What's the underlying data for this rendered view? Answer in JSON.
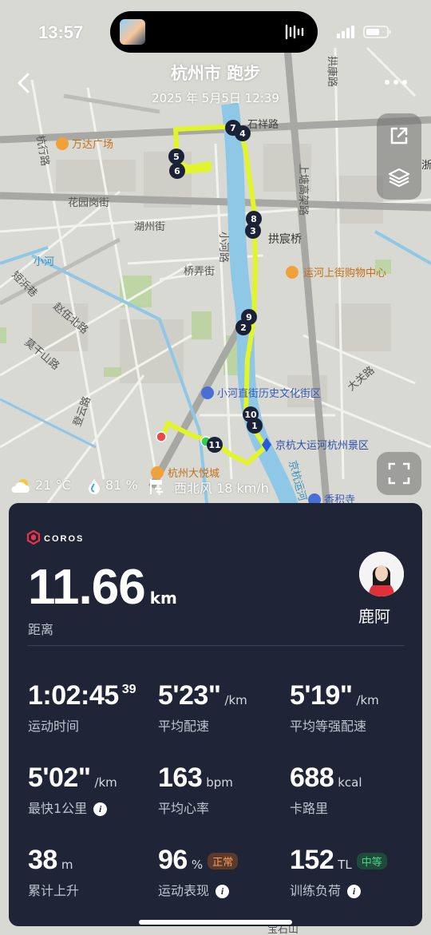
{
  "status_bar": {
    "time": "13:57"
  },
  "header": {
    "title": "杭州市 跑步",
    "subtitle": "2025 年 5月5日 12:39"
  },
  "map": {
    "labels": {
      "wanda": "万达广场",
      "shichiqiao": "石祥路",
      "gongchenqiao": "拱宸桥",
      "hangxing": "杭行路",
      "huayuangang": "花园岗街",
      "hubin": "湖州街",
      "qiaonong": "桥弄街",
      "xiaohe_road": "小河路",
      "xiaohe": "小河",
      "duanbang": "短浜巷",
      "zhaogong": "赵伍北路",
      "moganshan": "莫干山路",
      "dengyun": "登云路",
      "shangtang": "上塘高架路",
      "gongkang": "拱康路",
      "canal_mall": "运河上街购物中心",
      "historic": "小河直街历史文化街区",
      "scenic": "京杭大运河杭州景区",
      "mall": "杭州大悦城",
      "xiangji": "香积寺",
      "baoshi": "宝石山",
      "dagaun": "大关路",
      "canal_river": "京杭运河",
      "zheda": "浙大"
    },
    "markers": [
      "1",
      "2",
      "3",
      "4",
      "5",
      "6",
      "7",
      "8",
      "9",
      "10",
      "11"
    ],
    "route_color": "#e2f42a"
  },
  "weather": {
    "temp": "21 °C",
    "humidity": "81 %",
    "wind": "西北风 18 km/h"
  },
  "card": {
    "brand": "COROS",
    "distance_value": "11.66",
    "distance_unit": "km",
    "distance_label": "距离",
    "user_name": "鹿阿",
    "stats": {
      "duration": {
        "value": "1:02:45",
        "sup": "39",
        "label": "运动时间"
      },
      "avg_pace": {
        "value": "5'23\"",
        "unit": "/km",
        "label": "平均配速"
      },
      "gap_pace": {
        "value": "5'19\"",
        "unit": "/km",
        "label": "平均等强配速"
      },
      "fastest_km": {
        "value": "5'02\"",
        "unit": "/km",
        "label": "最快1公里"
      },
      "avg_hr": {
        "value": "163",
        "unit": "bpm",
        "label": "平均心率"
      },
      "calories": {
        "value": "688",
        "unit": "kcal",
        "label": "卡路里"
      },
      "ascent": {
        "value": "38",
        "unit": "m",
        "label": "累计上升"
      },
      "performance": {
        "value": "96",
        "unit": "%",
        "badge": "正常",
        "label": "运动表现"
      },
      "training_load": {
        "value": "152",
        "unit": "TL",
        "badge": "中等",
        "label": "训练负荷"
      }
    }
  },
  "colors": {
    "card_bg": "#1f2436",
    "route": "#e2f42a",
    "badge_normal": "#ff9a5e",
    "badge_medium": "#4bd08a"
  }
}
